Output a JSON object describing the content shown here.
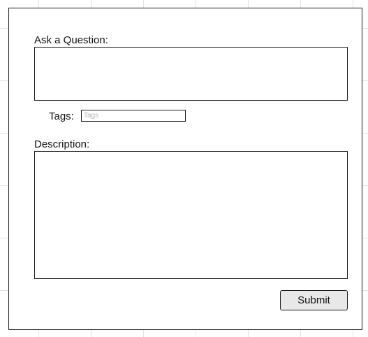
{
  "form": {
    "question": {
      "label": "Ask a Question:",
      "value": ""
    },
    "tags": {
      "label": "Tags:",
      "placeholder": "Tags",
      "value": ""
    },
    "description": {
      "label": "Description:",
      "value": ""
    },
    "submit_label": "Submit"
  },
  "colors": {
    "border": "#1a1a1a",
    "button_background": "#e8e8e8",
    "grid_lines": "#e3e3e3",
    "placeholder_text": "#b5b5b5"
  }
}
